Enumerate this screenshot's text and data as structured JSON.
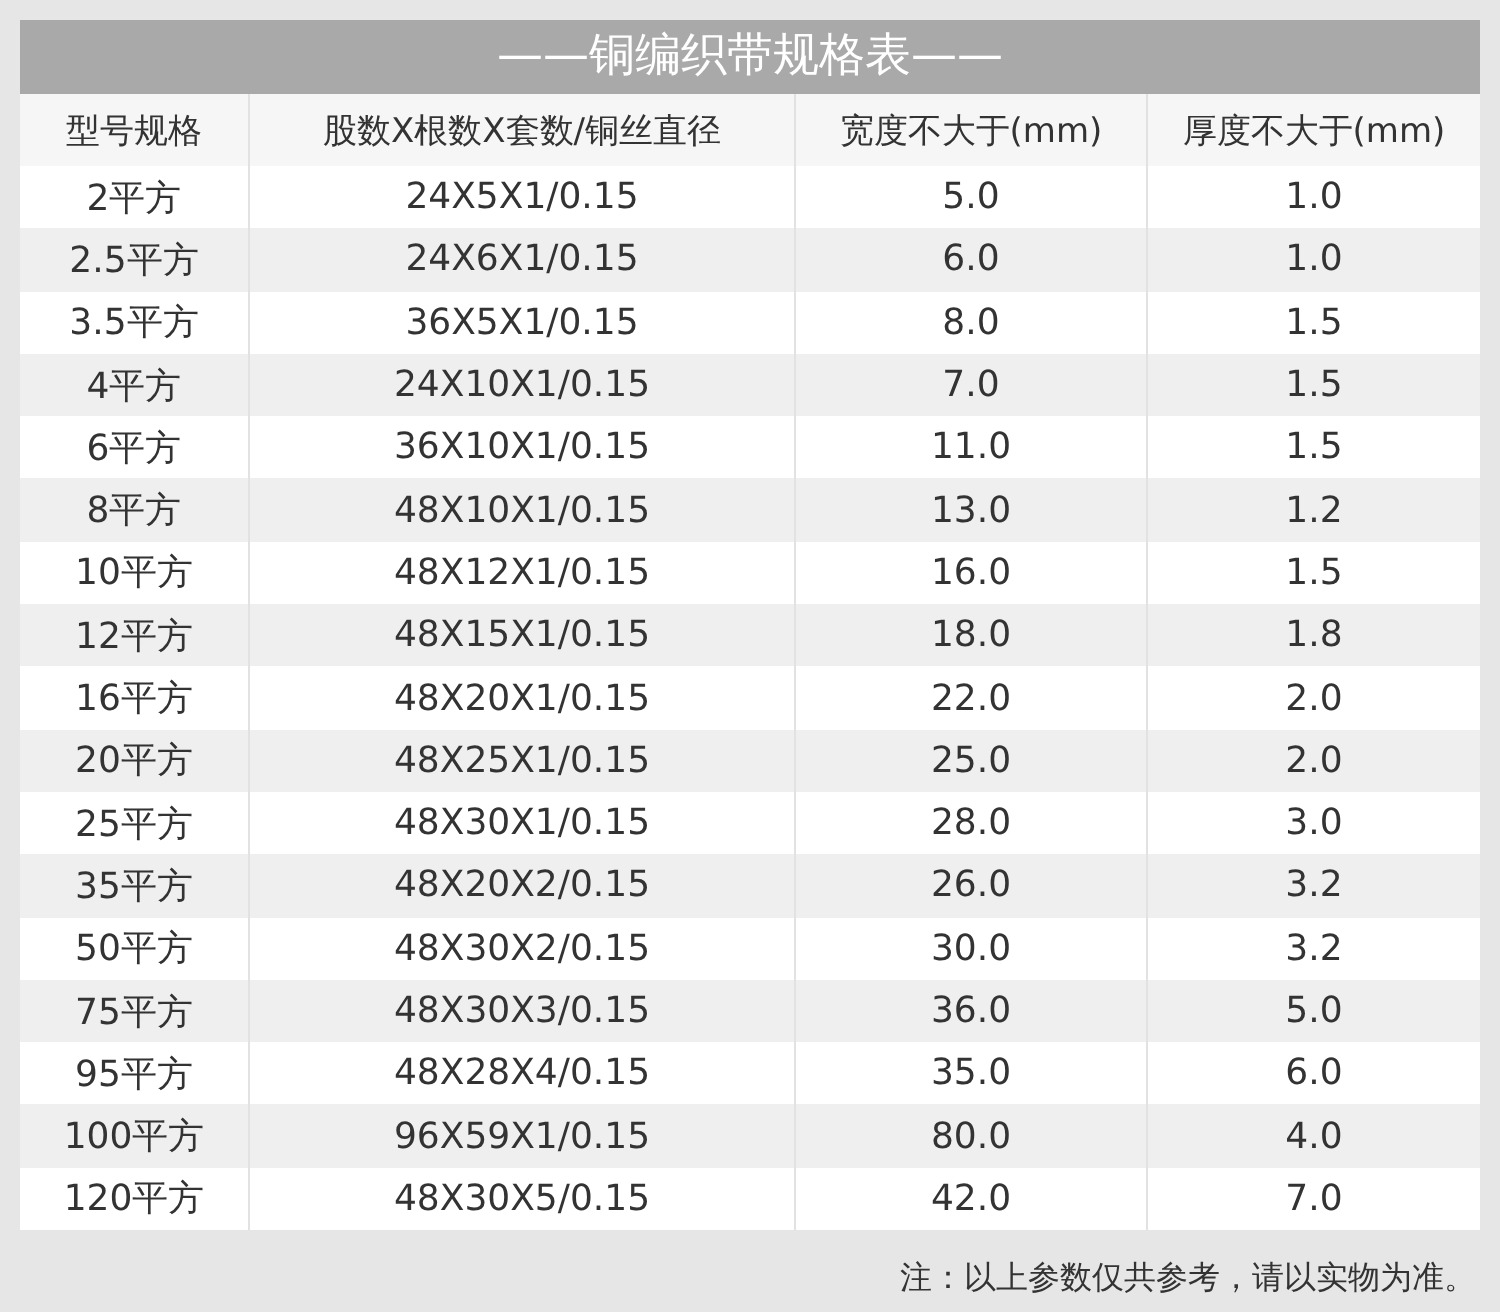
{
  "title": "——铜编织带规格表——",
  "table": {
    "columns": [
      "型号规格",
      "股数X根数X套数/铜丝直径",
      "宽度不大于(mm)",
      "厚度不大于(mm)"
    ],
    "rows": [
      [
        "2平方",
        "24X5X1/0.15",
        "5.0",
        "1.0"
      ],
      [
        "2.5平方",
        "24X6X1/0.15",
        "6.0",
        "1.0"
      ],
      [
        "3.5平方",
        "36X5X1/0.15",
        "8.0",
        "1.5"
      ],
      [
        "4平方",
        "24X10X1/0.15",
        "7.0",
        "1.5"
      ],
      [
        "6平方",
        "36X10X1/0.15",
        "11.0",
        "1.5"
      ],
      [
        "8平方",
        "48X10X1/0.15",
        "13.0",
        "1.2"
      ],
      [
        "10平方",
        "48X12X1/0.15",
        "16.0",
        "1.5"
      ],
      [
        "12平方",
        "48X15X1/0.15",
        "18.0",
        "1.8"
      ],
      [
        "16平方",
        "48X20X1/0.15",
        "22.0",
        "2.0"
      ],
      [
        "20平方",
        "48X25X1/0.15",
        "25.0",
        "2.0"
      ],
      [
        "25平方",
        "48X30X1/0.15",
        "28.0",
        "3.0"
      ],
      [
        "35平方",
        "48X20X2/0.15",
        "26.0",
        "3.2"
      ],
      [
        "50平方",
        "48X30X2/0.15",
        "30.0",
        "3.2"
      ],
      [
        "75平方",
        "48X30X3/0.15",
        "36.0",
        "5.0"
      ],
      [
        "95平方",
        "48X28X4/0.15",
        "35.0",
        "6.0"
      ],
      [
        "100平方",
        "96X59X1/0.15",
        "80.0",
        "4.0"
      ],
      [
        "120平方",
        "48X30X5/0.15",
        "42.0",
        "7.0"
      ]
    ]
  },
  "note": "注：以上参数仅共参考，请以实物为准。"
}
